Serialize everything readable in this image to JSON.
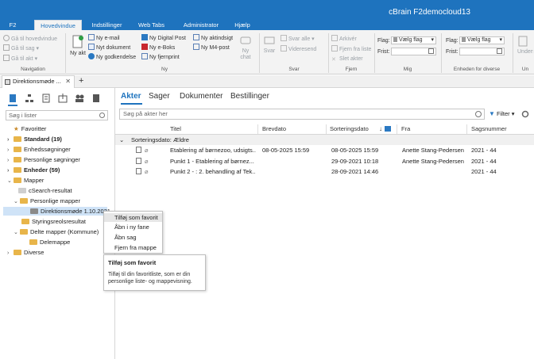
{
  "window": {
    "title": "cBrain F2democloud13"
  },
  "menu": [
    "F2",
    "Hovedvindue",
    "Indstillinger",
    "Web Tabs",
    "Administrator",
    "Hjælp"
  ],
  "ribbon": {
    "navigation": {
      "back": "Gå til hovedvindue",
      "go_to_tag": "Gå til sag",
      "go_to_file": "Gå til akt",
      "group": "Navigation"
    },
    "new": {
      "big": "Ny akt",
      "items": [
        "Ny e-mail",
        "Nyt dokument",
        "Ny godkendelse",
        "Ny Digital Post",
        "Ny e-Boks",
        "Ny fjernprint",
        "Ny aktindsigt",
        "Ny M4-post"
      ],
      "chat": "Ny chat",
      "group": "Ny"
    },
    "answer": {
      "big": "Svar",
      "reply_all": "Svar alle",
      "forward": "Videresend",
      "group": "Svar"
    },
    "remove": {
      "archive": "Arkivér",
      "remove_from_list": "Fjern fra liste",
      "delete": "Slet akter",
      "group": "Fjern"
    },
    "me": {
      "flag_label": "Flag:",
      "flag_value": "Vælg flag",
      "due_label": "Frist:",
      "group": "Mig"
    },
    "unit": {
      "flag_label": "Flag:",
      "flag_value": "Vælg flag",
      "due_label": "Frist:",
      "group": "Enheden for diverse"
    },
    "extra": {
      "label": "Underskriv",
      "group": "Un"
    }
  },
  "doc_tab": {
    "label": "Direktionsmøde ...",
    "add": "+"
  },
  "left": {
    "search_placeholder": "Søg i lister",
    "tree": [
      {
        "label": "Favoritter"
      },
      {
        "label": "Standard (19)"
      },
      {
        "label": "Enhedssøgninger"
      },
      {
        "label": "Personlige søgninger"
      },
      {
        "label": "Enheder (59)"
      },
      {
        "label": "Mapper"
      },
      {
        "label": "cSearch-resultat"
      },
      {
        "label": "Personlige mapper"
      },
      {
        "label": "Direktionsmøde 1.10.2021"
      },
      {
        "label": "Styringsreolsresultat"
      },
      {
        "label": "Delte mapper (Kommune)"
      },
      {
        "label": "Delemappe"
      },
      {
        "label": "Diverse"
      }
    ]
  },
  "main": {
    "tabs": [
      "Akter",
      "Sager",
      "Dokumenter",
      "Bestillinger"
    ],
    "search_placeholder": "Søg på akter her",
    "filter_label": "Filter",
    "columns": {
      "title": "Titel",
      "letter_date": "Brevdato",
      "sort_date": "Sorteringsdato",
      "from": "Fra",
      "case_no": "Sagsnummer"
    },
    "group_label": "Sorteringsdato: Ældre",
    "rows": [
      {
        "title": "Etablering af børnezoo, udsigts...",
        "letter_date": "08-05-2025 15:59",
        "sort_date": "08-05-2025 15:59",
        "from": "Anette Stang-Pedersen",
        "case_no": "2021 - 44"
      },
      {
        "title": "Punkt 1 -   Etablering af børnez...",
        "letter_date": "",
        "sort_date": "29-09-2021 10:18",
        "from": "Anette Stang-Pedersen",
        "case_no": "2021 - 44"
      },
      {
        "title": "Punkt 2 - : 2. behandling af Tek...",
        "letter_date": "",
        "sort_date": "28-09-2021 14:46",
        "from": "",
        "case_no": "2021 - 44"
      }
    ]
  },
  "context_menu": {
    "items": [
      "Tilføj som favorit",
      "Åbn i ny fane",
      "Åbn sag",
      "Fjern fra mappe"
    ],
    "tooltip_title": "Tilføj som favorit",
    "tooltip_body": "Tilføj til din favoritliste, som er din personlige liste- og mappevisning."
  },
  "colors": {
    "brand": "#1e73be",
    "accent": "#2b79c2",
    "selected_row": "#cfe3f7",
    "folder": "#e8b54a"
  }
}
